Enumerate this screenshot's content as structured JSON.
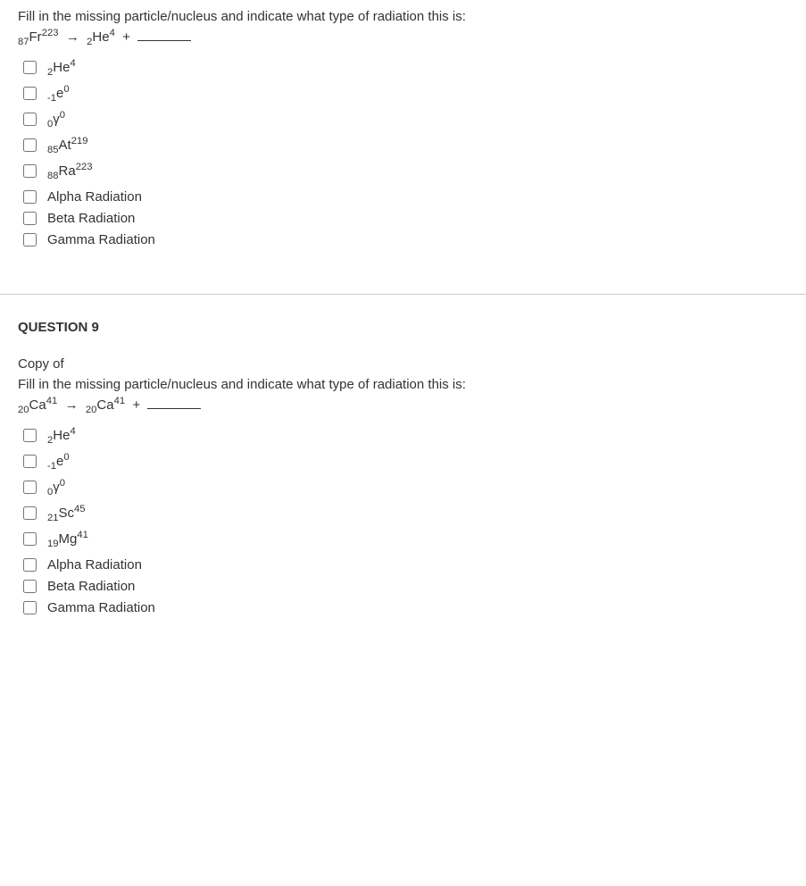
{
  "q8": {
    "prompt": "Fill in the missing particle/nucleus and indicate what type of radiation this is:",
    "eq_lhs_sub": "87",
    "eq_lhs_sym": "Fr",
    "eq_lhs_sup": "223",
    "eq_rhs1_sub": "2",
    "eq_rhs1_sym": "He",
    "eq_rhs1_sup": "4",
    "arrow": "→",
    "plus": "+",
    "opts": [
      {
        "type": "nuc",
        "sub": "2",
        "sym": "He",
        "sup": "4"
      },
      {
        "type": "nuc",
        "sub": "-1",
        "sym": "e",
        "sup": "0"
      },
      {
        "type": "nuc",
        "sub": "0",
        "sym": "γ",
        "sup": "0"
      },
      {
        "type": "nuc",
        "sub": "85",
        "sym": "At",
        "sup": "219"
      },
      {
        "type": "nuc",
        "sub": "88",
        "sym": "Ra",
        "sup": "223"
      },
      {
        "type": "txt",
        "label": "Alpha Radiation"
      },
      {
        "type": "txt",
        "label": "Beta Radiation"
      },
      {
        "type": "txt",
        "label": "Gamma Radiation"
      }
    ]
  },
  "q9": {
    "heading": "QUESTION 9",
    "copyof": "Copy of",
    "prompt": "Fill in the missing particle/nucleus and indicate what type of radiation this is:",
    "eq_lhs_sub": "20",
    "eq_lhs_sym": "Ca",
    "eq_lhs_sup": "41",
    "eq_rhs1_sub": "20",
    "eq_rhs1_sym": "Ca",
    "eq_rhs1_sup": "41",
    "arrow": "→",
    "plus": "+",
    "opts": [
      {
        "type": "nuc",
        "sub": "2",
        "sym": "He",
        "sup": "4"
      },
      {
        "type": "nuc",
        "sub": "-1",
        "sym": "e",
        "sup": "0"
      },
      {
        "type": "nuc",
        "sub": "0",
        "sym": "γ",
        "sup": "0"
      },
      {
        "type": "nuc",
        "sub": "21",
        "sym": "Sc",
        "sup": "45"
      },
      {
        "type": "nuc",
        "sub": "19",
        "sym": "Mg",
        "sup": "41"
      },
      {
        "type": "txt",
        "label": "Alpha Radiation"
      },
      {
        "type": "txt",
        "label": "Beta Radiation"
      },
      {
        "type": "txt",
        "label": "Gamma Radiation"
      }
    ]
  }
}
